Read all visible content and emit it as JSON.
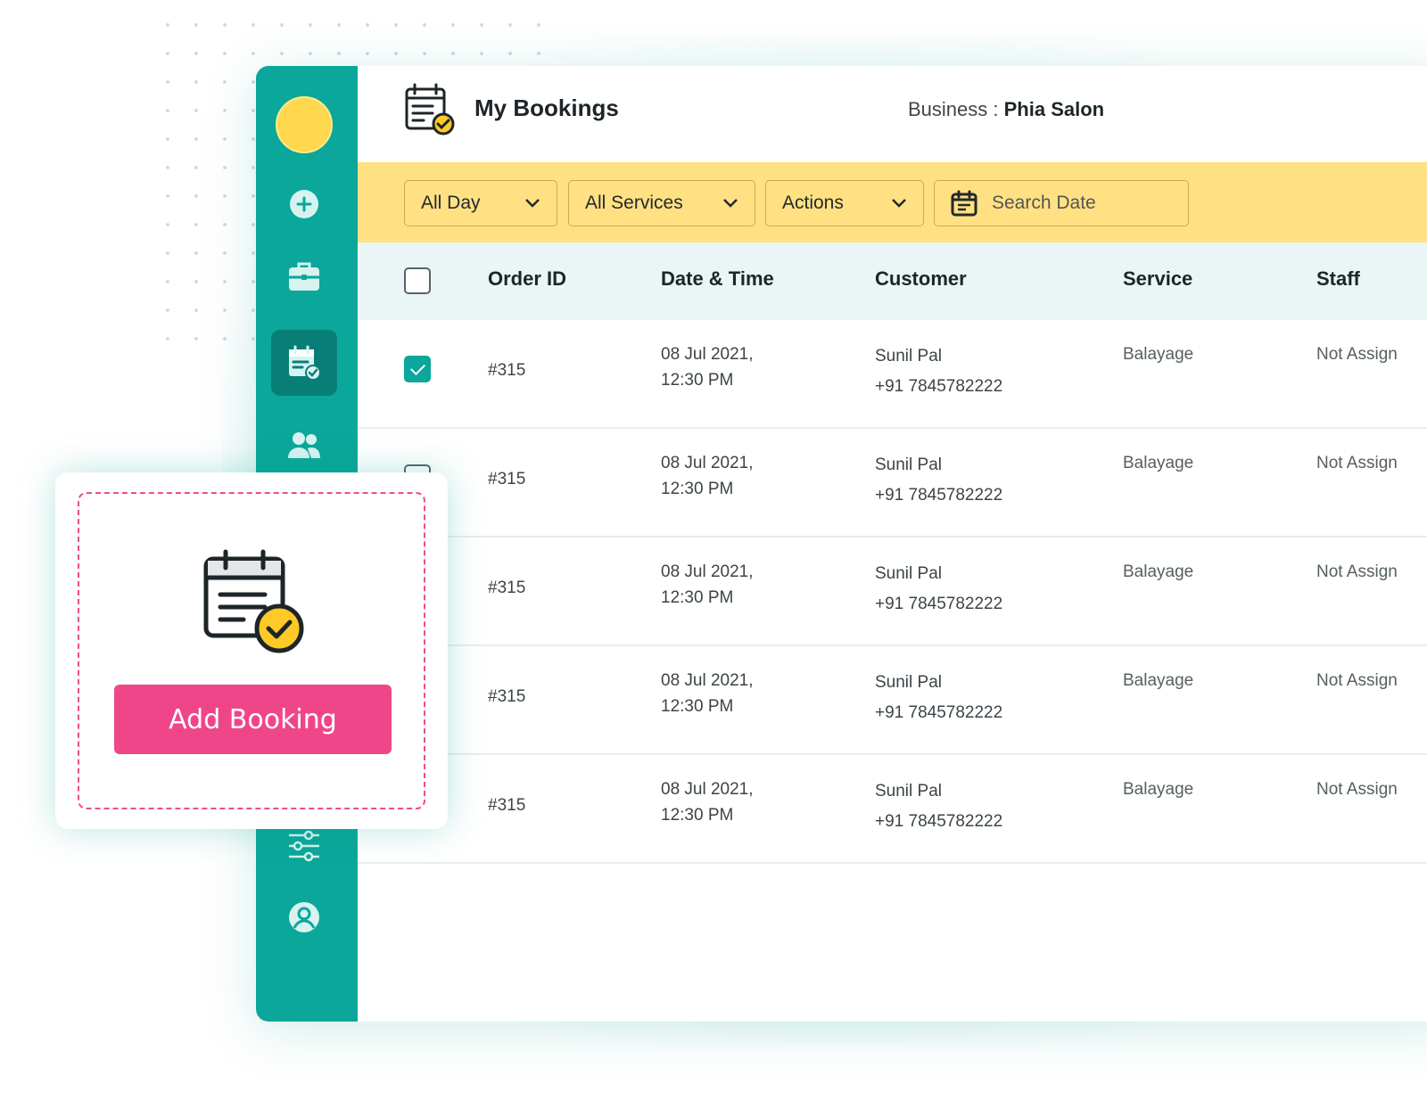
{
  "header": {
    "title": "My Bookings",
    "business_label": "Business :",
    "business_name": "Phia Salon"
  },
  "sidebar": {
    "items": [
      {
        "icon": "plus-circle-icon"
      },
      {
        "icon": "briefcase-icon"
      },
      {
        "icon": "calendar-check-icon",
        "active": true
      },
      {
        "icon": "users-icon"
      },
      {
        "icon": "sliders-icon"
      },
      {
        "icon": "user-circle-icon"
      }
    ]
  },
  "filters": {
    "day": "All Day",
    "services": "All Services",
    "actions": "Actions",
    "search_date_placeholder": "Search Date"
  },
  "table": {
    "columns": [
      "Order ID",
      "Date & Time",
      "Customer",
      "Service",
      "Staff"
    ],
    "rows": [
      {
        "checked": true,
        "order_id": "#315",
        "date": "08 Jul 2021,",
        "time": "12:30 PM",
        "customer": "Sunil Pal",
        "phone": "+91 7845782222",
        "service": "Balayage",
        "staff": "Not Assign"
      },
      {
        "checked": false,
        "order_id": "#315",
        "date": "08 Jul 2021,",
        "time": "12:30 PM",
        "customer": "Sunil Pal",
        "phone": "+91 7845782222",
        "service": "Balayage",
        "staff": "Not Assign"
      },
      {
        "checked": false,
        "order_id": "#315",
        "date": "08 Jul 2021,",
        "time": "12:30 PM",
        "customer": "Sunil Pal",
        "phone": "+91 7845782222",
        "service": "Balayage",
        "staff": "Not Assign"
      },
      {
        "checked": false,
        "order_id": "#315",
        "date": "08 Jul 2021,",
        "time": "12:30 PM",
        "customer": "Sunil Pal",
        "phone": "+91 7845782222",
        "service": "Balayage",
        "staff": "Not Assign"
      },
      {
        "checked": false,
        "order_id": "#315",
        "date": "08 Jul 2021,",
        "time": "12:30 PM",
        "customer": "Sunil Pal",
        "phone": "+91 7845782222",
        "service": "Balayage",
        "staff": "Not Assign"
      }
    ]
  },
  "popup": {
    "button_label": "Add Booking",
    "icon": "calendar-check-icon"
  },
  "colors": {
    "sidebar": "#0aa79a",
    "sidebar_active": "#087f76",
    "filterbar": "#ffe183",
    "table_header": "#e9f6f5",
    "accent_pink": "#ef468a",
    "logo_yellow": "#ffd84f"
  }
}
